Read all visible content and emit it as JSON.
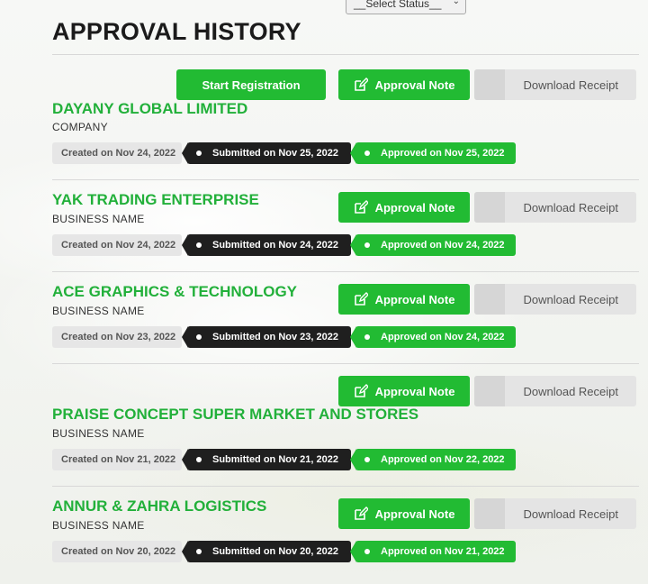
{
  "filter": {
    "status_select": "__Select Status__"
  },
  "page_title": "APPROVAL HISTORY",
  "buttons": {
    "start_registration": "Start Registration",
    "approval_note": "Approval Note",
    "download_receipt": "Download Receipt"
  },
  "records": [
    {
      "name": "DAYANY GLOBAL LIMITED",
      "type": "COMPANY",
      "created": "Created on Nov 24, 2022",
      "submitted": "Submitted on Nov 25, 2022",
      "approved": "Approved on Nov 25, 2022"
    },
    {
      "name": "YAK TRADING ENTERPRISE",
      "type": "BUSINESS NAME",
      "created": "Created on Nov 24, 2022",
      "submitted": "Submitted on Nov 24, 2022",
      "approved": "Approved on Nov 24, 2022"
    },
    {
      "name": "ACE GRAPHICS & TECHNOLOGY",
      "type": "BUSINESS NAME",
      "created": "Created on Nov 23, 2022",
      "submitted": "Submitted on Nov 23, 2022",
      "approved": "Approved on Nov 24, 2022"
    },
    {
      "name": "PRAISE CONCEPT SUPER MARKET AND STORES",
      "type": "BUSINESS NAME",
      "created": "Created on Nov 21, 2022",
      "submitted": "Submitted on Nov 21, 2022",
      "approved": "Approved on Nov 22, 2022"
    },
    {
      "name": "ANNUR & ZAHRA LOGISTICS",
      "type": "BUSINESS NAME",
      "created": "Created on Nov 20, 2022",
      "submitted": "Submitted on Nov 20, 2022",
      "approved": "Approved on Nov 21, 2022"
    }
  ],
  "colors": {
    "accent": "#22bb33",
    "dark_pill": "#1f1f1f",
    "grey_pill": "#e6e6e6"
  },
  "icons": {
    "approval_note": "edit-icon",
    "select": "chevron-down-icon"
  }
}
